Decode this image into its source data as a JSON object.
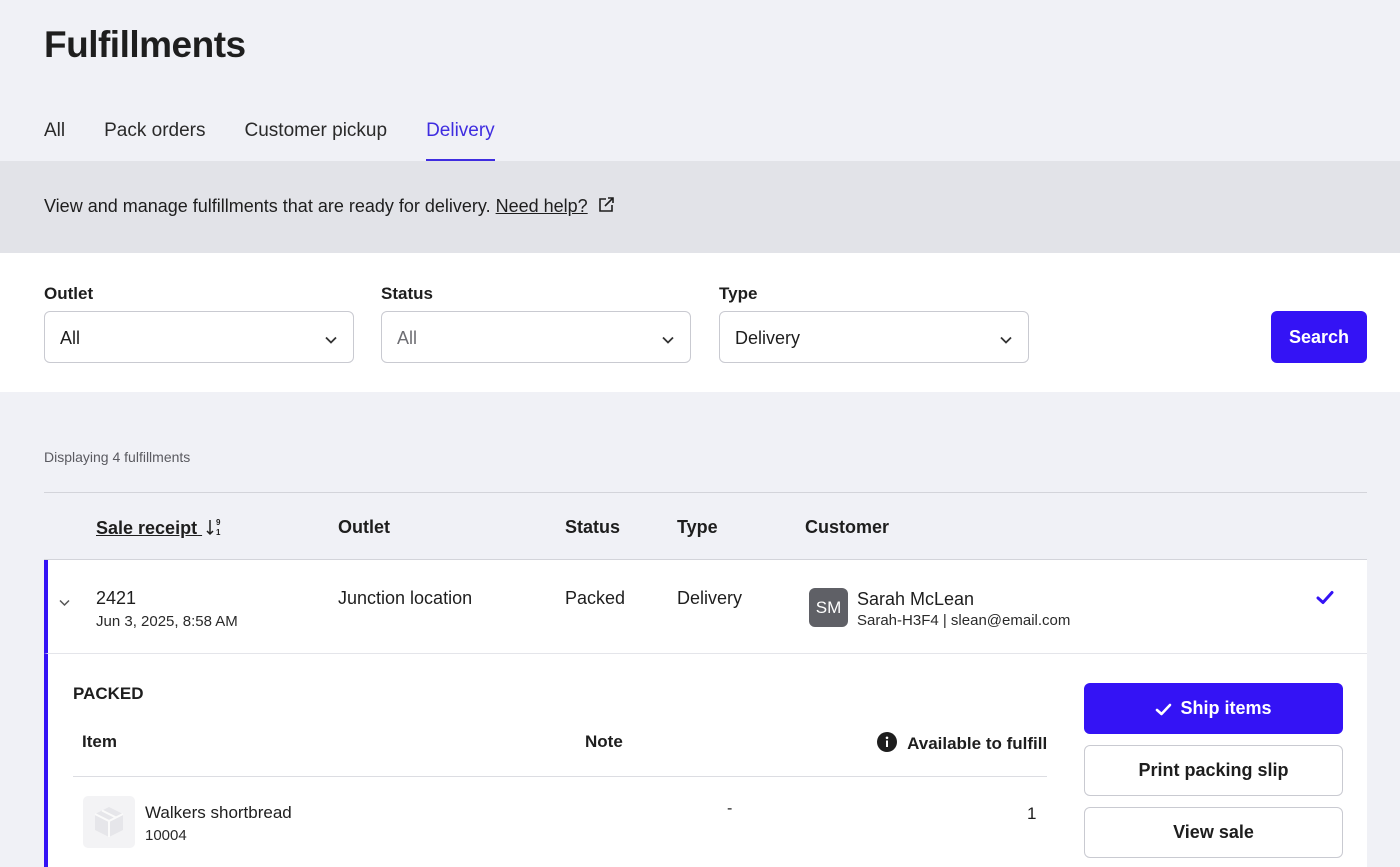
{
  "page": {
    "title": "Fulfillments"
  },
  "tabs": [
    {
      "label": "All"
    },
    {
      "label": "Pack orders"
    },
    {
      "label": "Customer pickup"
    },
    {
      "label": "Delivery",
      "active": true
    }
  ],
  "banner": {
    "text": "View and manage fulfillments that are ready for delivery.",
    "help_link": "Need help?",
    "help_icon": "external-link-icon"
  },
  "filters": {
    "outlet": {
      "label": "Outlet",
      "value": "All"
    },
    "status": {
      "label": "Status",
      "value": "All"
    },
    "type": {
      "label": "Type",
      "value": "Delivery"
    },
    "search_label": "Search"
  },
  "results": {
    "count_text": "Displaying 4 fulfillments",
    "columns": {
      "sale_receipt": "Sale receipt",
      "outlet": "Outlet",
      "status": "Status",
      "type": "Type",
      "customer": "Customer"
    },
    "rows": [
      {
        "receipt": "2421",
        "date": "Jun 3, 2025, 8:58 AM",
        "outlet": "Junction location",
        "status": "Packed",
        "type": "Delivery",
        "customer": {
          "initials": "SM",
          "name": "Sarah McLean",
          "details": "Sarah-H3F4 | slean@email.com"
        },
        "selected_icon": "checkmark-icon"
      }
    ]
  },
  "detail": {
    "section_title": "PACKED",
    "columns": {
      "item": "Item",
      "note": "Note",
      "available": "Available to fulfill"
    },
    "items": [
      {
        "name": "Walkers shortbread",
        "sku": "10004",
        "note": "-",
        "available": "1"
      }
    ],
    "actions": {
      "ship": "Ship items",
      "print": "Print packing slip",
      "view": "View sale"
    }
  },
  "colors": {
    "accent": "#3413f5",
    "tab_active": "#3f2de0",
    "header_bg": "#f0f1f6",
    "banner_bg": "#e2e3e8"
  }
}
